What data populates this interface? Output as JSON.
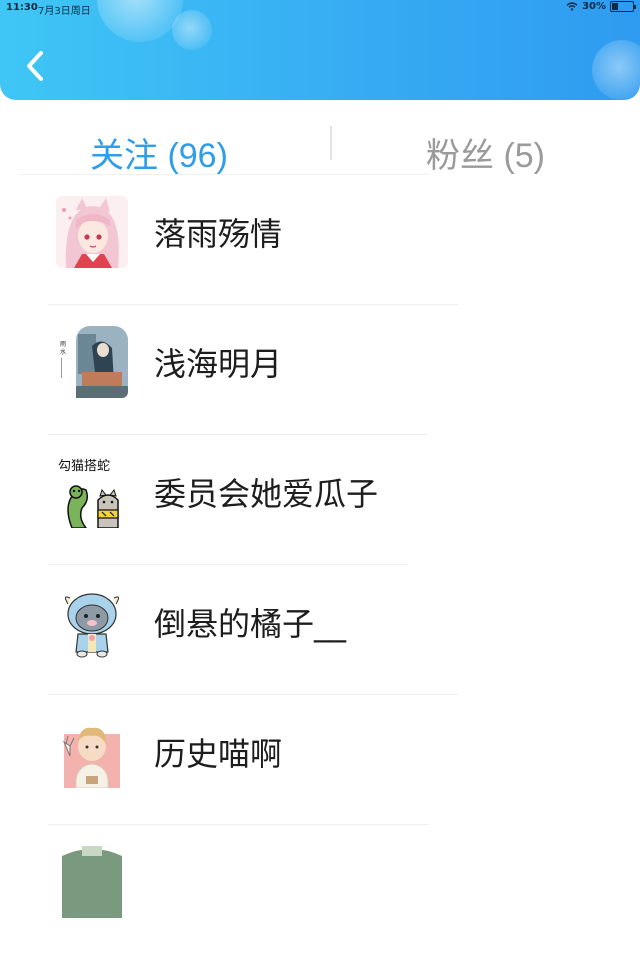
{
  "status_bar": {
    "time": "11:30",
    "date": "7月3日周日",
    "battery": "30%"
  },
  "tabs": [
    {
      "label": "关注 (96)"
    },
    {
      "label": "粉丝 (5)"
    }
  ],
  "users": [
    {
      "name": "落雨殇情",
      "avatar": "pink-hair-girl-avatar"
    },
    {
      "name": "浅海明月",
      "avatar": "illustration-book-avatar"
    },
    {
      "name": "委员会她爱瓜子",
      "avatar": "snake-cartoon-avatar"
    },
    {
      "name": "倒悬的橘子__",
      "avatar": "cow-costume-cat-avatar"
    },
    {
      "name": "历史喵啊",
      "avatar": "boy-with-cat-avatar"
    }
  ],
  "icons": {
    "back": "chevron-left-icon",
    "wifi": "wifi-icon",
    "battery": "battery-icon"
  },
  "colors": {
    "header": "#37acf3",
    "active_tab": "#2f9ee8",
    "inactive_tab": "#9a9a9a"
  }
}
